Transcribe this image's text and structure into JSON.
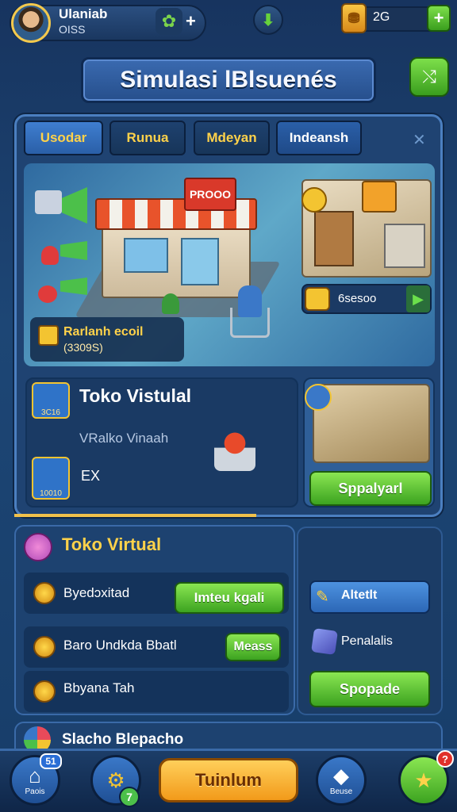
{
  "profile": {
    "name": "Ulaniab",
    "sub": "OISS",
    "avatar_icon": "player-avatar"
  },
  "topbar": {
    "coins": "2G",
    "leaf_icon": "leaf-icon",
    "plus": "+",
    "down_icon": "arrow-down-icon"
  },
  "title": "Simulasi lBlsuenés",
  "share_icon": "share-icon",
  "tabs": [
    "Usodar",
    "Runua",
    "Mdeyan",
    "Indeansh"
  ],
  "tab_close": "✕",
  "scene": {
    "shop_sign": "PROOO",
    "reward_label": "Rarlanh ecoil",
    "reward_value": "(3309S)",
    "store2_value": "6sesoo"
  },
  "toko_card": {
    "title": "Toko Vistulal",
    "subtitle": "VRalko Vinaah",
    "ex_label": "EX",
    "icon1_text": "3C16",
    "icon2_text": "10010",
    "button": "Sppalyarl"
  },
  "section2": {
    "title": "Toko Virtual",
    "rows": [
      {
        "label": "Byedɔxitad",
        "button": "Imteu kgali"
      },
      {
        "label": "Baro Undkda Bbatl",
        "button": "Meass"
      },
      {
        "label": "Bbyana Tah"
      }
    ],
    "side": {
      "button_label": "Altetlt",
      "item_label": "Penalalis",
      "action": "Spopade"
    }
  },
  "partial_row": {
    "title": "Slacho Blepacho"
  },
  "bottom_nav": {
    "home_label": "Paois",
    "home_badge": "51",
    "settings_badge": "7",
    "main_button": "Tuinlum",
    "shop_label": "Beuse",
    "star_badge": "?"
  },
  "colors": {
    "accent": "#ffd24a",
    "green": "#3ca320",
    "orange": "#f29a1a",
    "panel": "#1f4372"
  }
}
